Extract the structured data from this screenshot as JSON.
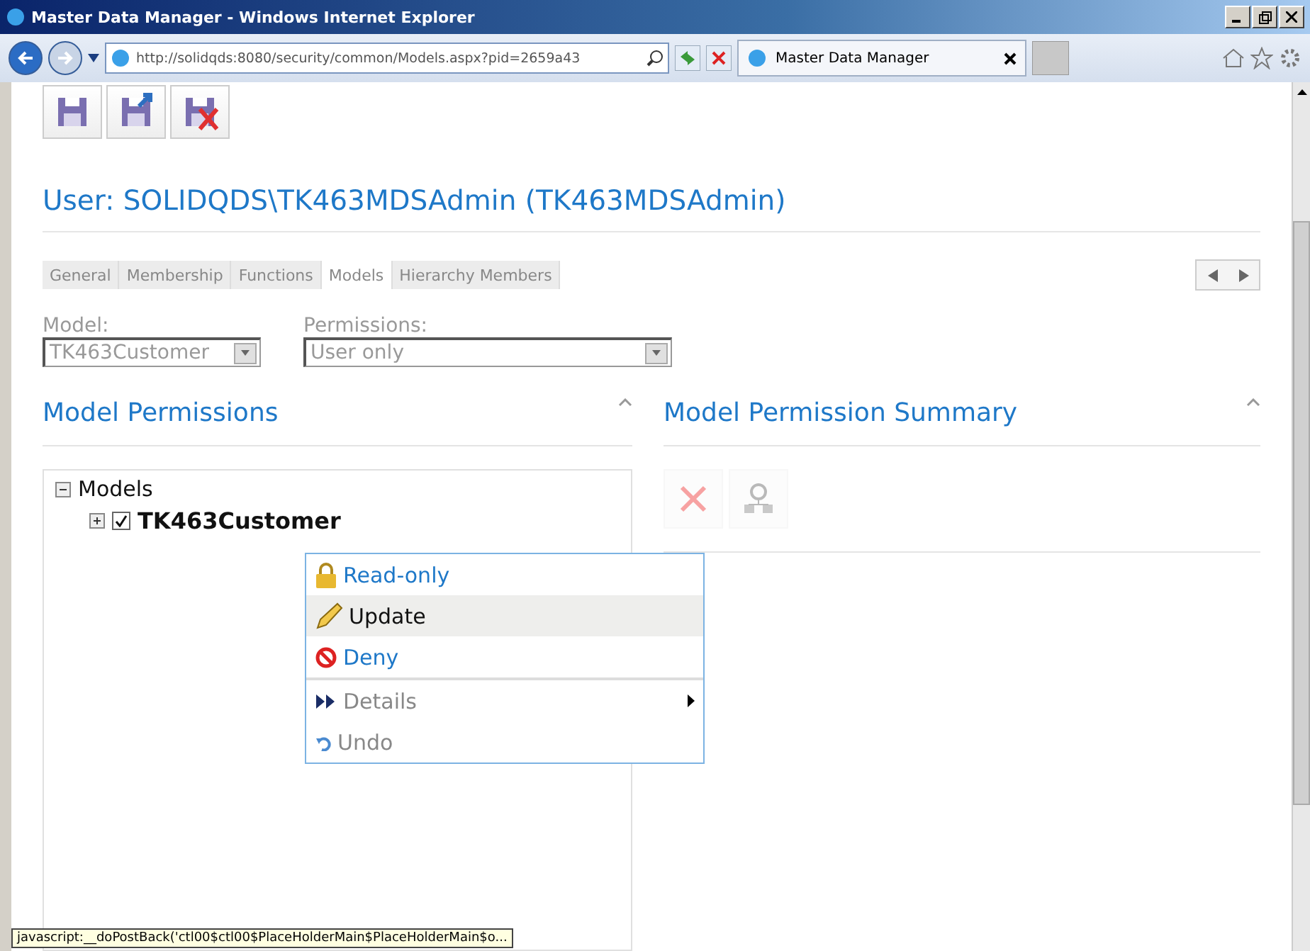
{
  "window": {
    "title": "Master Data Manager - Windows Internet Explorer"
  },
  "address_bar": {
    "url": "http://solidqds:8080/security/common/Models.aspx?pid=2659a43"
  },
  "browser_tabs": [
    {
      "label": "Master Data Manager",
      "selected": true
    }
  ],
  "toolbar": [
    {
      "kind": "save"
    },
    {
      "kind": "save-close"
    },
    {
      "kind": "cancel"
    }
  ],
  "page_title": "User: SOLIDQDS\\TK463MDSAdmin (TK463MDSAdmin)",
  "tabs": [
    {
      "label": "General",
      "selected": false
    },
    {
      "label": "Membership",
      "selected": false
    },
    {
      "label": "Functions",
      "selected": false
    },
    {
      "label": "Models",
      "selected": true
    },
    {
      "label": "Hierarchy Members",
      "selected": false
    }
  ],
  "filters": [
    {
      "label": "Model:",
      "value": "TK463Customer",
      "disabled": true,
      "wide": false
    },
    {
      "label": "Permissions:",
      "value": "User only",
      "disabled": true,
      "wide": true
    }
  ],
  "left_panel": {
    "title": "Model Permissions",
    "tree": [
      {
        "label": "Models",
        "expanded": true,
        "children": [
          {
            "label": "TK463Customer",
            "expanded": false,
            "checked": true
          }
        ]
      }
    ]
  },
  "right_panel": {
    "title": "Model Permission Summary",
    "buttons": [
      {
        "kind": "delete",
        "disabled": true
      },
      {
        "kind": "hierarchy",
        "disabled": true
      }
    ]
  },
  "context_menu": [
    {
      "kind": "readonly",
      "label": "Read-only",
      "highlighted": false,
      "disabled": false,
      "submenu": false
    },
    {
      "kind": "update",
      "label": "Update",
      "highlighted": true,
      "disabled": false,
      "submenu": false
    },
    {
      "kind": "deny",
      "label": "Deny",
      "highlighted": false,
      "disabled": false,
      "submenu": false
    },
    {
      "kind": "details",
      "label": "Details",
      "highlighted": false,
      "disabled": true,
      "submenu": true
    },
    {
      "kind": "undo",
      "label": "Undo",
      "highlighted": false,
      "disabled": true,
      "submenu": false
    }
  ],
  "status_bar": {
    "text": "javascript:__doPostBack('ctl00$ctl00$PlaceHolderMain$PlaceHolderMain$o..."
  }
}
